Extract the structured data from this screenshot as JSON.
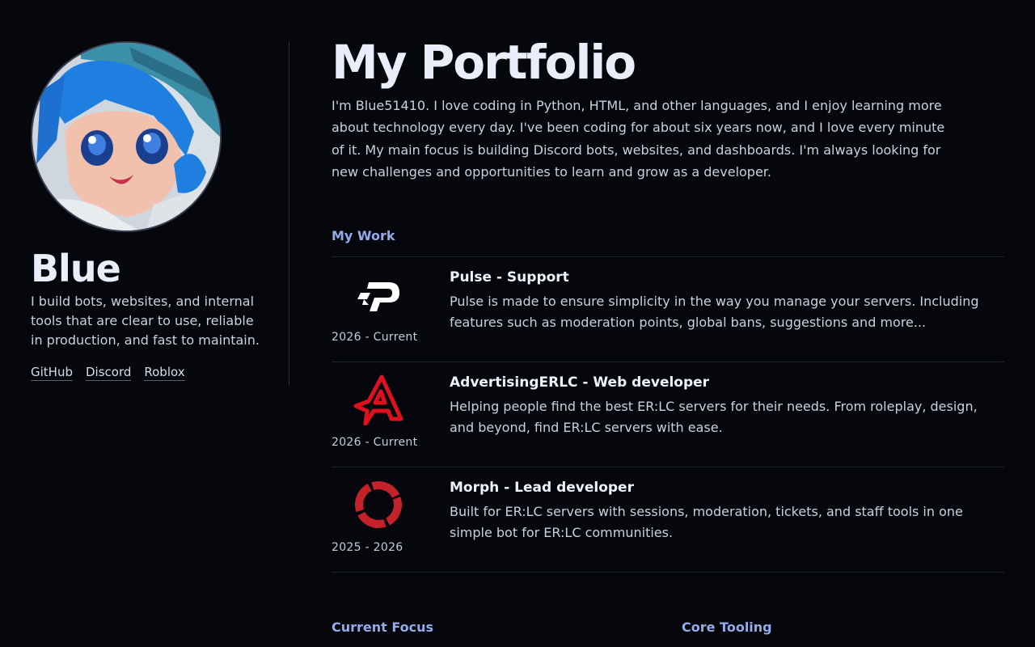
{
  "profile": {
    "name": "Blue",
    "bio": "I build bots, websites, and internal tools that are clear to use, reliable in production, and fast to maintain.",
    "links": [
      {
        "label": "GitHub"
      },
      {
        "label": "Discord"
      },
      {
        "label": "Roblox"
      }
    ]
  },
  "main": {
    "title": "My Portfolio",
    "intro": "I'm Blue51410. I love coding in Python, HTML, and other languages, and I enjoy learning more about technology every day. I've been coding for about six years now, and I love every minute of it. My main focus is building Discord bots, websites, and dashboards. I'm always looking for new challenges and opportunities to learn and grow as a developer.",
    "work_heading": "My Work",
    "work": [
      {
        "title": "Pulse - Support",
        "dates": "2026 - Current",
        "description": "Pulse is made to ensure simplicity in the way you manage your servers. Including features such as moderation points, global bans, suggestions and more...",
        "logo_icon": "pulse-logo-icon"
      },
      {
        "title": "AdvertisingERLC - Web developer",
        "dates": "2026 - Current",
        "description": "Helping people find the best ER:LC servers for their needs. From roleplay, design, and beyond, find ER:LC servers with ease.",
        "logo_icon": "advertisingerlc-logo-icon"
      },
      {
        "title": "Morph - Lead developer",
        "dates": "2025 - 2026",
        "description": "Built for ER:LC servers with sessions, moderation, tickets, and staff tools in one simple bot for ER:LC communities.",
        "logo_icon": "morph-logo-icon"
      }
    ],
    "focus_heading": "Current Focus",
    "tooling_heading": "Core Tooling"
  },
  "colors": {
    "background": "#05070d",
    "accent": "#93abe9",
    "text": "#c9d0de",
    "heading": "#e9eefb",
    "advertising_red": "#e0101e",
    "morph_red": "#c4222a"
  }
}
